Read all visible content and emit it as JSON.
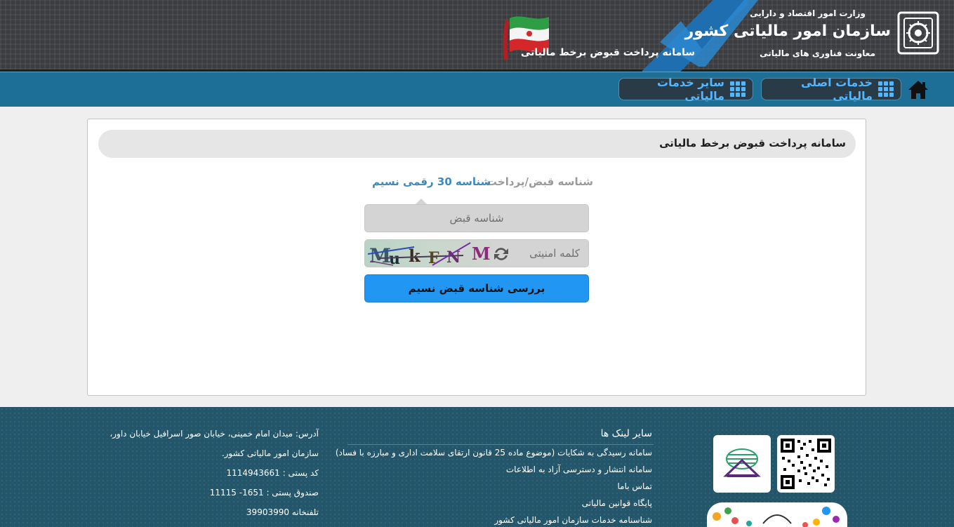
{
  "header": {
    "ministry": "وزارت امور اقتصاد و دارایی",
    "org_name": "سازمان امور مالیاتی کشور",
    "org_sub": "معاونت فناوری های مالیاتی",
    "site_title": "سامانه پرداخت قبوض برخط مالیاتی"
  },
  "nav": {
    "home_icon": "home-icon",
    "main_services": "خدمات اصلی مالیاتی",
    "other_services": "سایر خدمات مالیاتی"
  },
  "card": {
    "title": "سامانه پرداخت قبوض برخط مالیاتی",
    "tabs": [
      {
        "label": "شناسه قبض/پرداخت",
        "active": false
      },
      {
        "label": "شناسه 30 رقمی نسیم",
        "active": true
      }
    ],
    "receipt_placeholder": "شناسه قبض",
    "captcha_placeholder": "کلمه امنیتی",
    "submit_label": "بررسی شناسه قبض نسیم"
  },
  "footer": {
    "address_lines": [
      "آدرس: میدان امام خمینی، خیابان صور اسرافیل خیابان داور،",
      "سازمان امور مالیاتی کشور.",
      "کد پستی : 1114943661",
      "صندوق پستی : 1651- 11115",
      "تلفنخانه 39903990"
    ],
    "links_title": "سایر لینک ها",
    "links": [
      "سامانه رسیدگی به شکایات (موضوع ماده 25 قانون ارتقای سلامت اداری و مبارزه با فساد)",
      "سامانه انتشار و دسترسی آزاد به اطلاعات",
      "تماس باما",
      "پایگاه قوانین مالیاتی",
      "شناسنامه خدمات سازمان امور مالیاتی کشور"
    ]
  },
  "colors": {
    "nav_bg": "#1e6f98",
    "pill_text": "#52b7ff",
    "button_bg": "#2196f3",
    "active_tab": "#3a8ac0",
    "footer_bg": "#24566b"
  }
}
